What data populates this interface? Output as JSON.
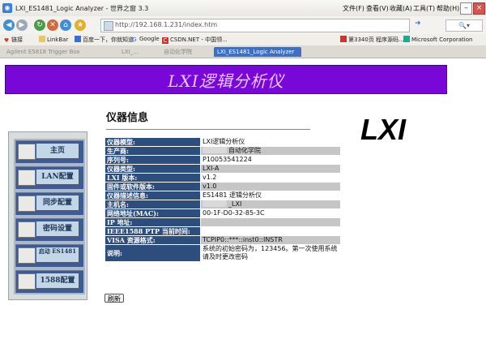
{
  "browser": {
    "title": "LXI_ES1481_Logic Analyzer - 世界之窗 3.3",
    "menu": [
      "文件(F)",
      "查看(V)",
      "收藏(A)",
      "工具(T)",
      "帮助(H)"
    ],
    "url": "http://192.168.1.231/index.htm",
    "favorites": [
      "链接",
      "LinkBar",
      "百度一下，你就知道",
      "Google",
      "CSDN.NET - 中国领...",
      "第3340页 程序源码...",
      "Microsoft Corporation"
    ],
    "tabs": [
      "Agilent E5818 Trigger Box",
      "LXI_...",
      "自动化学院",
      "LXI_ES1481_Logic Analyzer"
    ]
  },
  "banner": {
    "title": "LXI逻辑分析仪"
  },
  "page": {
    "heading": "仪器信息",
    "refresh_label": "刷新"
  },
  "sidebar": [
    {
      "label": "主页",
      "icon": "home-icon"
    },
    {
      "label": "LAN配置",
      "icon": "network-icon"
    },
    {
      "label": "同步配置",
      "icon": "sync-icon"
    },
    {
      "label": "密码设置",
      "icon": "keyboard-icon"
    },
    {
      "label": "启动 ES1481",
      "icon": "run-icon"
    },
    {
      "label": "1588配置",
      "icon": "clock-icon"
    }
  ],
  "info": {
    "rows": [
      {
        "key": "仪器模型:",
        "value": "LXI逻辑分析仪"
      },
      {
        "key": "生产商:",
        "value": "自动化学院"
      },
      {
        "key": "序列号:",
        "value": "P10053541224"
      },
      {
        "key": "仪器类型:",
        "value": "LXI-A"
      },
      {
        "key": "LXI 版本:",
        "value": "v1.2"
      },
      {
        "key": "固件或软件版本:",
        "value": "v1.0"
      },
      {
        "key": "仪器描述信息:",
        "value": "ES1481 逻辑分析仪"
      },
      {
        "key": "主机名:",
        "value": "_LXI"
      },
      {
        "key": "网络地址(MAC):",
        "value": "00-1F-D0-32-85-3C"
      },
      {
        "key": "IP 地址:",
        "value": ""
      },
      {
        "key": "IEEE1588 PTP 当前时间:",
        "value": ""
      },
      {
        "key": "VISA 资源格式:",
        "value": "TCPIP0::***::inst0::INSTR"
      },
      {
        "key": "说明:",
        "value": "系统的初始密码为，123456。第一次使用系统请及时更改密码"
      }
    ]
  },
  "colors": {
    "banner": "#7908d8",
    "table_key": "#2d4d7c",
    "table_alt": "#c6c6c6"
  }
}
